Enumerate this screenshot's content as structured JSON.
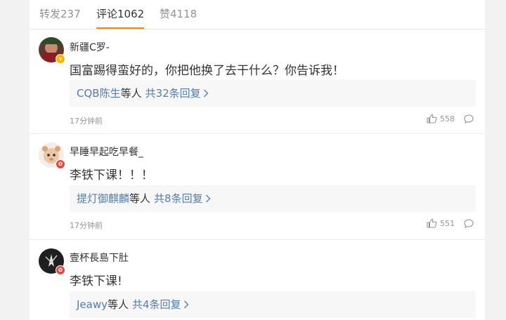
{
  "tabs": {
    "repost": "转发237",
    "comments": "评论1062",
    "likes": "赞4118"
  },
  "comments": [
    {
      "username": "新疆C罗-",
      "text": "国富踢得蛮好的，你把他换了去干什么？你告诉我！",
      "reply_name": "CQB陈生",
      "reply_suffix": "等人",
      "reply_count": "共32条回复",
      "time": "17分钟前",
      "likes": "558",
      "badge": "gold"
    },
    {
      "username": "早睡早起吃早餐_",
      "text": "李铁下课！！！",
      "reply_name": "提灯御麒麟",
      "reply_suffix": "等人",
      "reply_count": "共8条回复",
      "time": "17分钟前",
      "likes": "551",
      "badge": "red"
    },
    {
      "username": "壹杯長島下肚",
      "text": "李铁下课!",
      "reply_name": "Jeawy",
      "reply_suffix": "等人",
      "reply_count": "共4条回复",
      "badge": "red"
    }
  ],
  "colors": {
    "accent": "#ff8200",
    "link": "#507daf",
    "muted": "#939393"
  },
  "icons": [
    "thumb-up-icon",
    "comment-bubble-icon",
    "chevron-right-icon",
    "vip-badge-icon"
  ]
}
